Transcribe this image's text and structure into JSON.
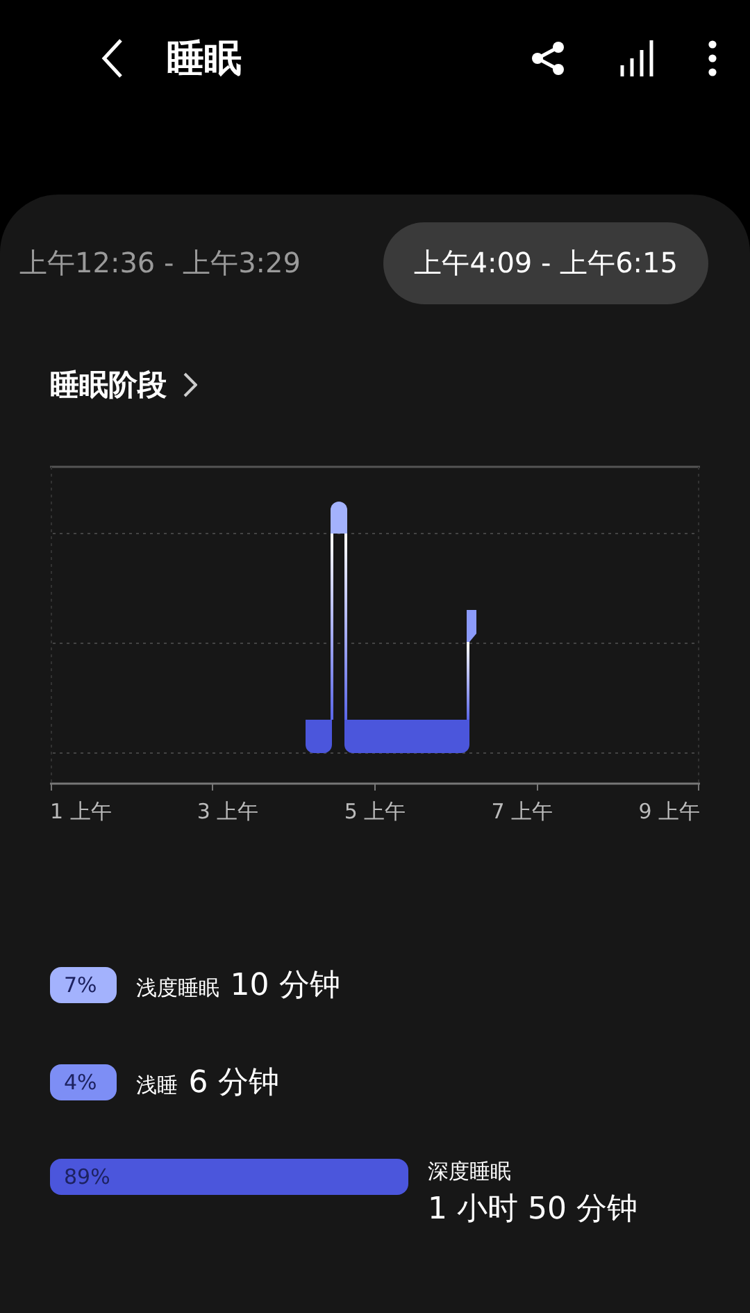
{
  "header": {
    "title": "睡眠"
  },
  "tabs": [
    {
      "label": "上午12:36 - 上午3:29",
      "selected": false
    },
    {
      "label": "上午4:09 - 上午6:15",
      "selected": true
    }
  ],
  "section": {
    "title": "睡眠阶段"
  },
  "chart": {
    "x_labels": [
      "1 上午",
      "3 上午",
      "5 上午",
      "7 上午",
      "9 上午"
    ]
  },
  "stages": [
    {
      "percent": "7%",
      "label": "浅度睡眠",
      "duration": "10 分钟",
      "kind": "short",
      "color": "#a3b2fd"
    },
    {
      "percent": "4%",
      "label": "浅睡",
      "duration": "6 分钟",
      "kind": "short",
      "color": "#7d8ef5"
    },
    {
      "percent": "89%",
      "label": "深度睡眠",
      "duration": "1 小时 50 分钟",
      "kind": "wide",
      "color": "#4b56dc"
    }
  ]
}
